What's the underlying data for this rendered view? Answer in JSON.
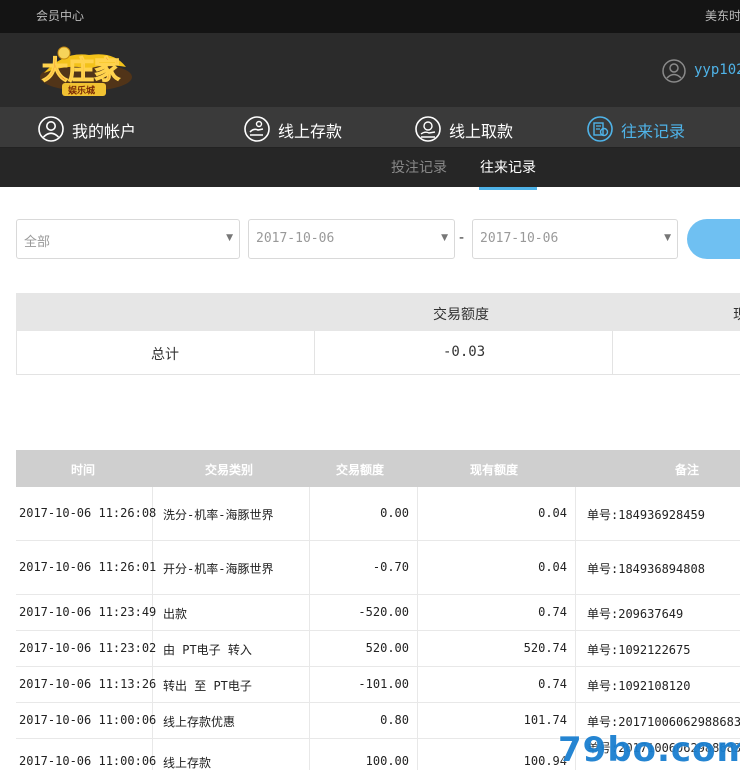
{
  "topbar": {
    "left": "会员中心",
    "right": "美东时"
  },
  "header": {
    "username": "yyp102"
  },
  "nav": [
    {
      "label": "我的帐户",
      "icon": "user-icon"
    },
    {
      "label": "线上存款",
      "icon": "deposit-icon"
    },
    {
      "label": "线上取款",
      "icon": "withdraw-icon"
    },
    {
      "label": "往来记录",
      "icon": "records-icon"
    }
  ],
  "subnav": [
    {
      "label": "投注记录"
    },
    {
      "label": "往来记录"
    }
  ],
  "filters": {
    "type": "全部",
    "date_from": "2017-10-06",
    "separator": "-",
    "date_to": "2017-10-06"
  },
  "summary": {
    "col_amount": "交易额度",
    "col_balance_partial": "现",
    "row_label": "总计",
    "amount": "-0.03"
  },
  "records": {
    "headers": [
      "时间",
      "交易类别",
      "交易额度",
      "现有额度",
      "备注"
    ],
    "rows": [
      {
        "time": "2017-10-06 11:26:08",
        "type": "洗分-机率-海豚世界",
        "amount": "0.00",
        "balance": "0.04",
        "note": "单号:184936928459"
      },
      {
        "time": "2017-10-06 11:26:01",
        "type": "开分-机率-海豚世界",
        "amount": "-0.70",
        "balance": "0.04",
        "note": "单号:184936894808"
      },
      {
        "time": "2017-10-06 11:23:49",
        "type": "出款",
        "amount": "-520.00",
        "balance": "0.74",
        "note": "单号:209637649"
      },
      {
        "time": "2017-10-06 11:23:02",
        "type": "由 PT电子 转入",
        "amount": "520.00",
        "balance": "520.74",
        "note": "单号:1092122675"
      },
      {
        "time": "2017-10-06 11:13:26",
        "type": "转出 至 PT电子",
        "amount": "-101.00",
        "balance": "0.74",
        "note": "单号:1092108120"
      },
      {
        "time": "2017-10-06 11:00:06",
        "type": "线上存款优惠",
        "amount": "0.80",
        "balance": "101.74",
        "note": "单号:20171006062988683"
      },
      {
        "time": "2017-10-06 11:00:06",
        "type": "线上存款",
        "amount": "100.00",
        "balance": "100.94",
        "note": "单号:20171006062988683"
      }
    ]
  },
  "watermark": "79bo.com",
  "colors": {
    "accent": "#4fb3e8",
    "topbar": "#141414",
    "header": "#2b2b2b",
    "nav": "#3a3a3a",
    "subnav": "#262626"
  }
}
